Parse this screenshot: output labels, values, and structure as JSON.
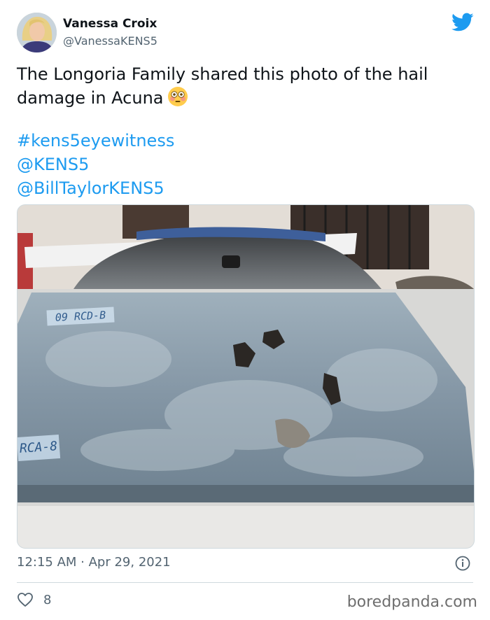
{
  "tweet": {
    "author_name": "Vanessa Croix",
    "author_handle": "@VanessaKENS5",
    "text_line1": "The Longoria Family shared this photo of the hail",
    "text_line2": "damage in Acuna",
    "hashtag": "#kens5eyewitness",
    "mention1": "@KENS5",
    "mention2": "@BillTaylorKENS5",
    "timestamp": "12:15 AM · Apr 29, 2021",
    "like_count": "8"
  },
  "photo": {
    "plate_top": "09 RCD-B",
    "plate_left": "RCA-8"
  },
  "watermark": "boredpanda.com",
  "icons": [
    "twitter-bird-icon",
    "flushed-face-emoji-icon",
    "info-icon",
    "heart-icon"
  ],
  "colors": {
    "link": "#1d9bf0",
    "text": "#0f1419",
    "muted": "#536471",
    "twitter_blue": "#1d9bf0"
  }
}
